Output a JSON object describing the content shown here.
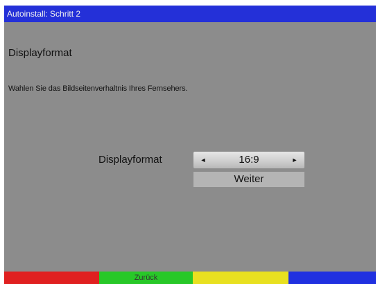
{
  "window": {
    "title": "Autoinstall: Schritt 2"
  },
  "main": {
    "heading": "Displayformat",
    "instruction": "Wahlen Sie das Bildseitenverhaltnis Ihres Fernsehers.",
    "field_label": "Displayformat",
    "selector": {
      "value": "16:9",
      "left_arrow": "◄",
      "right_arrow": "►"
    },
    "next_label": "Weiter"
  },
  "footer": {
    "green_label": "Zurück"
  },
  "colors": {
    "title_bar": "#2430d8",
    "background": "#8c8c8c",
    "red": "#e02020",
    "green": "#28c828",
    "yellow": "#e8e020",
    "blue": "#2030e0"
  }
}
